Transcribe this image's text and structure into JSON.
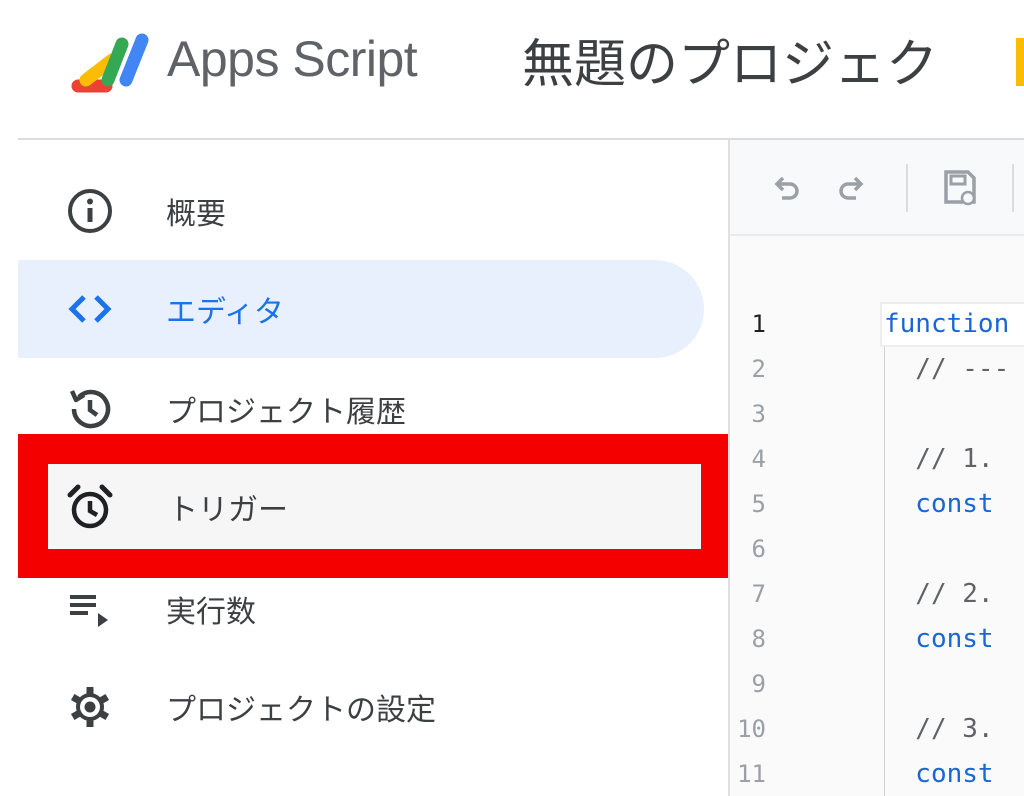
{
  "header": {
    "app_name": "Apps Script",
    "project_title": "無題のプロジェク"
  },
  "sidebar": {
    "items": [
      {
        "label": "概要",
        "icon": "info-icon"
      },
      {
        "label": "エディタ",
        "icon": "code-brackets-icon",
        "active": true
      },
      {
        "label": "プロジェクト履歴",
        "icon": "history-icon"
      },
      {
        "label": "トリガー",
        "icon": "alarm-clock-icon",
        "highlighted": true
      },
      {
        "label": "実行数",
        "icon": "executions-list-icon"
      },
      {
        "label": "プロジェクトの設定",
        "icon": "gear-icon"
      }
    ]
  },
  "toolbar": {
    "buttons": [
      "undo-icon",
      "redo-icon",
      "save-icon"
    ]
  },
  "editor": {
    "current_line": "1",
    "lines": [
      {
        "num": "1",
        "code": "function"
      },
      {
        "num": "2",
        "code": "  // ---"
      },
      {
        "num": "3",
        "code": ""
      },
      {
        "num": "4",
        "code": "  // 1."
      },
      {
        "num": "5",
        "code": "  const"
      },
      {
        "num": "6",
        "code": ""
      },
      {
        "num": "7",
        "code": "  // 2."
      },
      {
        "num": "8",
        "code": "  const"
      },
      {
        "num": "9",
        "code": ""
      },
      {
        "num": "10",
        "code": "  // 3."
      },
      {
        "num": "11",
        "code": "  const"
      }
    ]
  },
  "colors": {
    "accent": "#1a73e8",
    "active_bg": "#e8f0fe",
    "highlight_border": "#f40000",
    "keyword": "#1967d2"
  }
}
